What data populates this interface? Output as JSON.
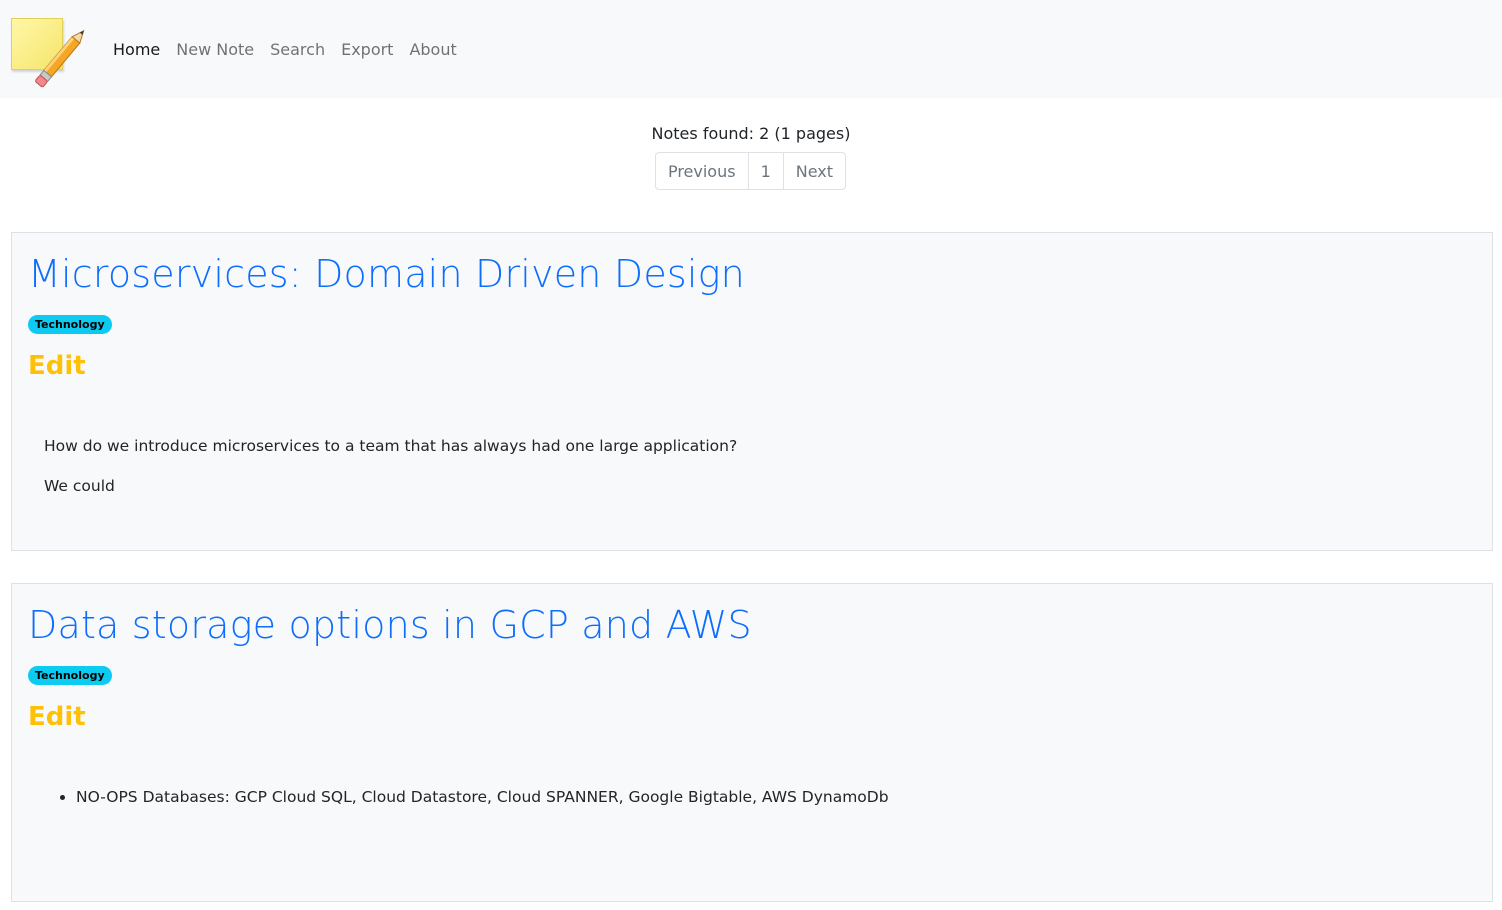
{
  "nav": {
    "logo_alt": "Sticky note with pencil",
    "links": [
      {
        "label": "Home",
        "active": true
      },
      {
        "label": "New Note",
        "active": false
      },
      {
        "label": "Search",
        "active": false
      },
      {
        "label": "Export",
        "active": false
      },
      {
        "label": "About",
        "active": false
      }
    ]
  },
  "summary": "Notes found: 2 (1 pages)",
  "pagination": {
    "previous": "Previous",
    "page": "1",
    "next": "Next"
  },
  "notes": [
    {
      "title": "Microservices: Domain Driven Design",
      "tag": "Technology",
      "edit_label": "Edit",
      "paragraphs": [
        "How do we introduce microservices to a team that has always had one large application?",
        "We could"
      ]
    },
    {
      "title": "Data storage options in GCP and AWS",
      "tag": "Technology",
      "edit_label": "Edit",
      "list_items": [
        "NO-OPS Databases: GCP Cloud SQL, Cloud Datastore, Cloud SPANNER, Google Bigtable, AWS DynamoDb"
      ]
    }
  ],
  "colors": {
    "title": "#0d6efd",
    "badge": "#0dcaf0",
    "edit": "#ffc107",
    "navbar_bg": "#f8f9fa"
  }
}
